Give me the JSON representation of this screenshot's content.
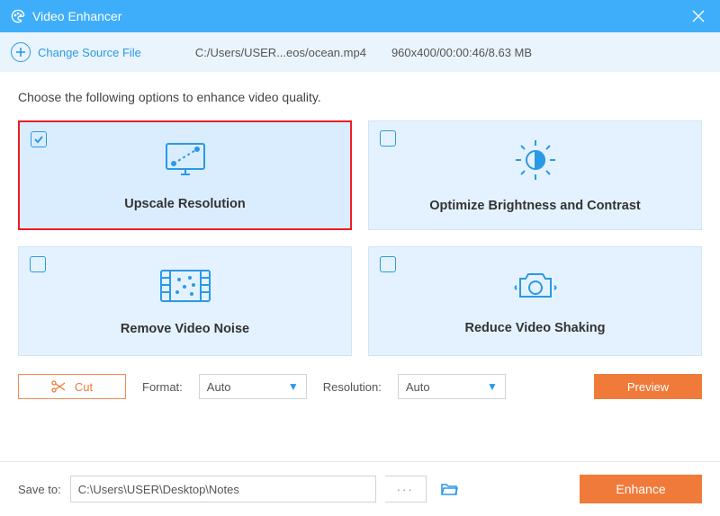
{
  "titlebar": {
    "title": "Video Enhancer"
  },
  "sourcebar": {
    "change_label": "Change Source File",
    "filepath": "C:/Users/USER...eos/ocean.mp4",
    "fileinfo": "960x400/00:00:46/8.63 MB"
  },
  "instruction": "Choose the following options to enhance video quality.",
  "options": {
    "upscale": {
      "label": "Upscale Resolution",
      "checked": true
    },
    "brightness": {
      "label": "Optimize Brightness and Contrast",
      "checked": false
    },
    "noise": {
      "label": "Remove Video Noise",
      "checked": false
    },
    "shaking": {
      "label": "Reduce Video Shaking",
      "checked": false
    }
  },
  "controls": {
    "cut_label": "Cut",
    "format_label": "Format:",
    "format_value": "Auto",
    "resolution_label": "Resolution:",
    "resolution_value": "Auto",
    "preview_label": "Preview"
  },
  "footer": {
    "save_label": "Save to:",
    "save_path": "C:\\Users\\USER\\Desktop\\Notes",
    "more": "···",
    "enhance_label": "Enhance"
  },
  "colors": {
    "accent_blue": "#3eaefb",
    "accent_orange": "#f07a3a",
    "selected_red": "#ed1c24"
  }
}
